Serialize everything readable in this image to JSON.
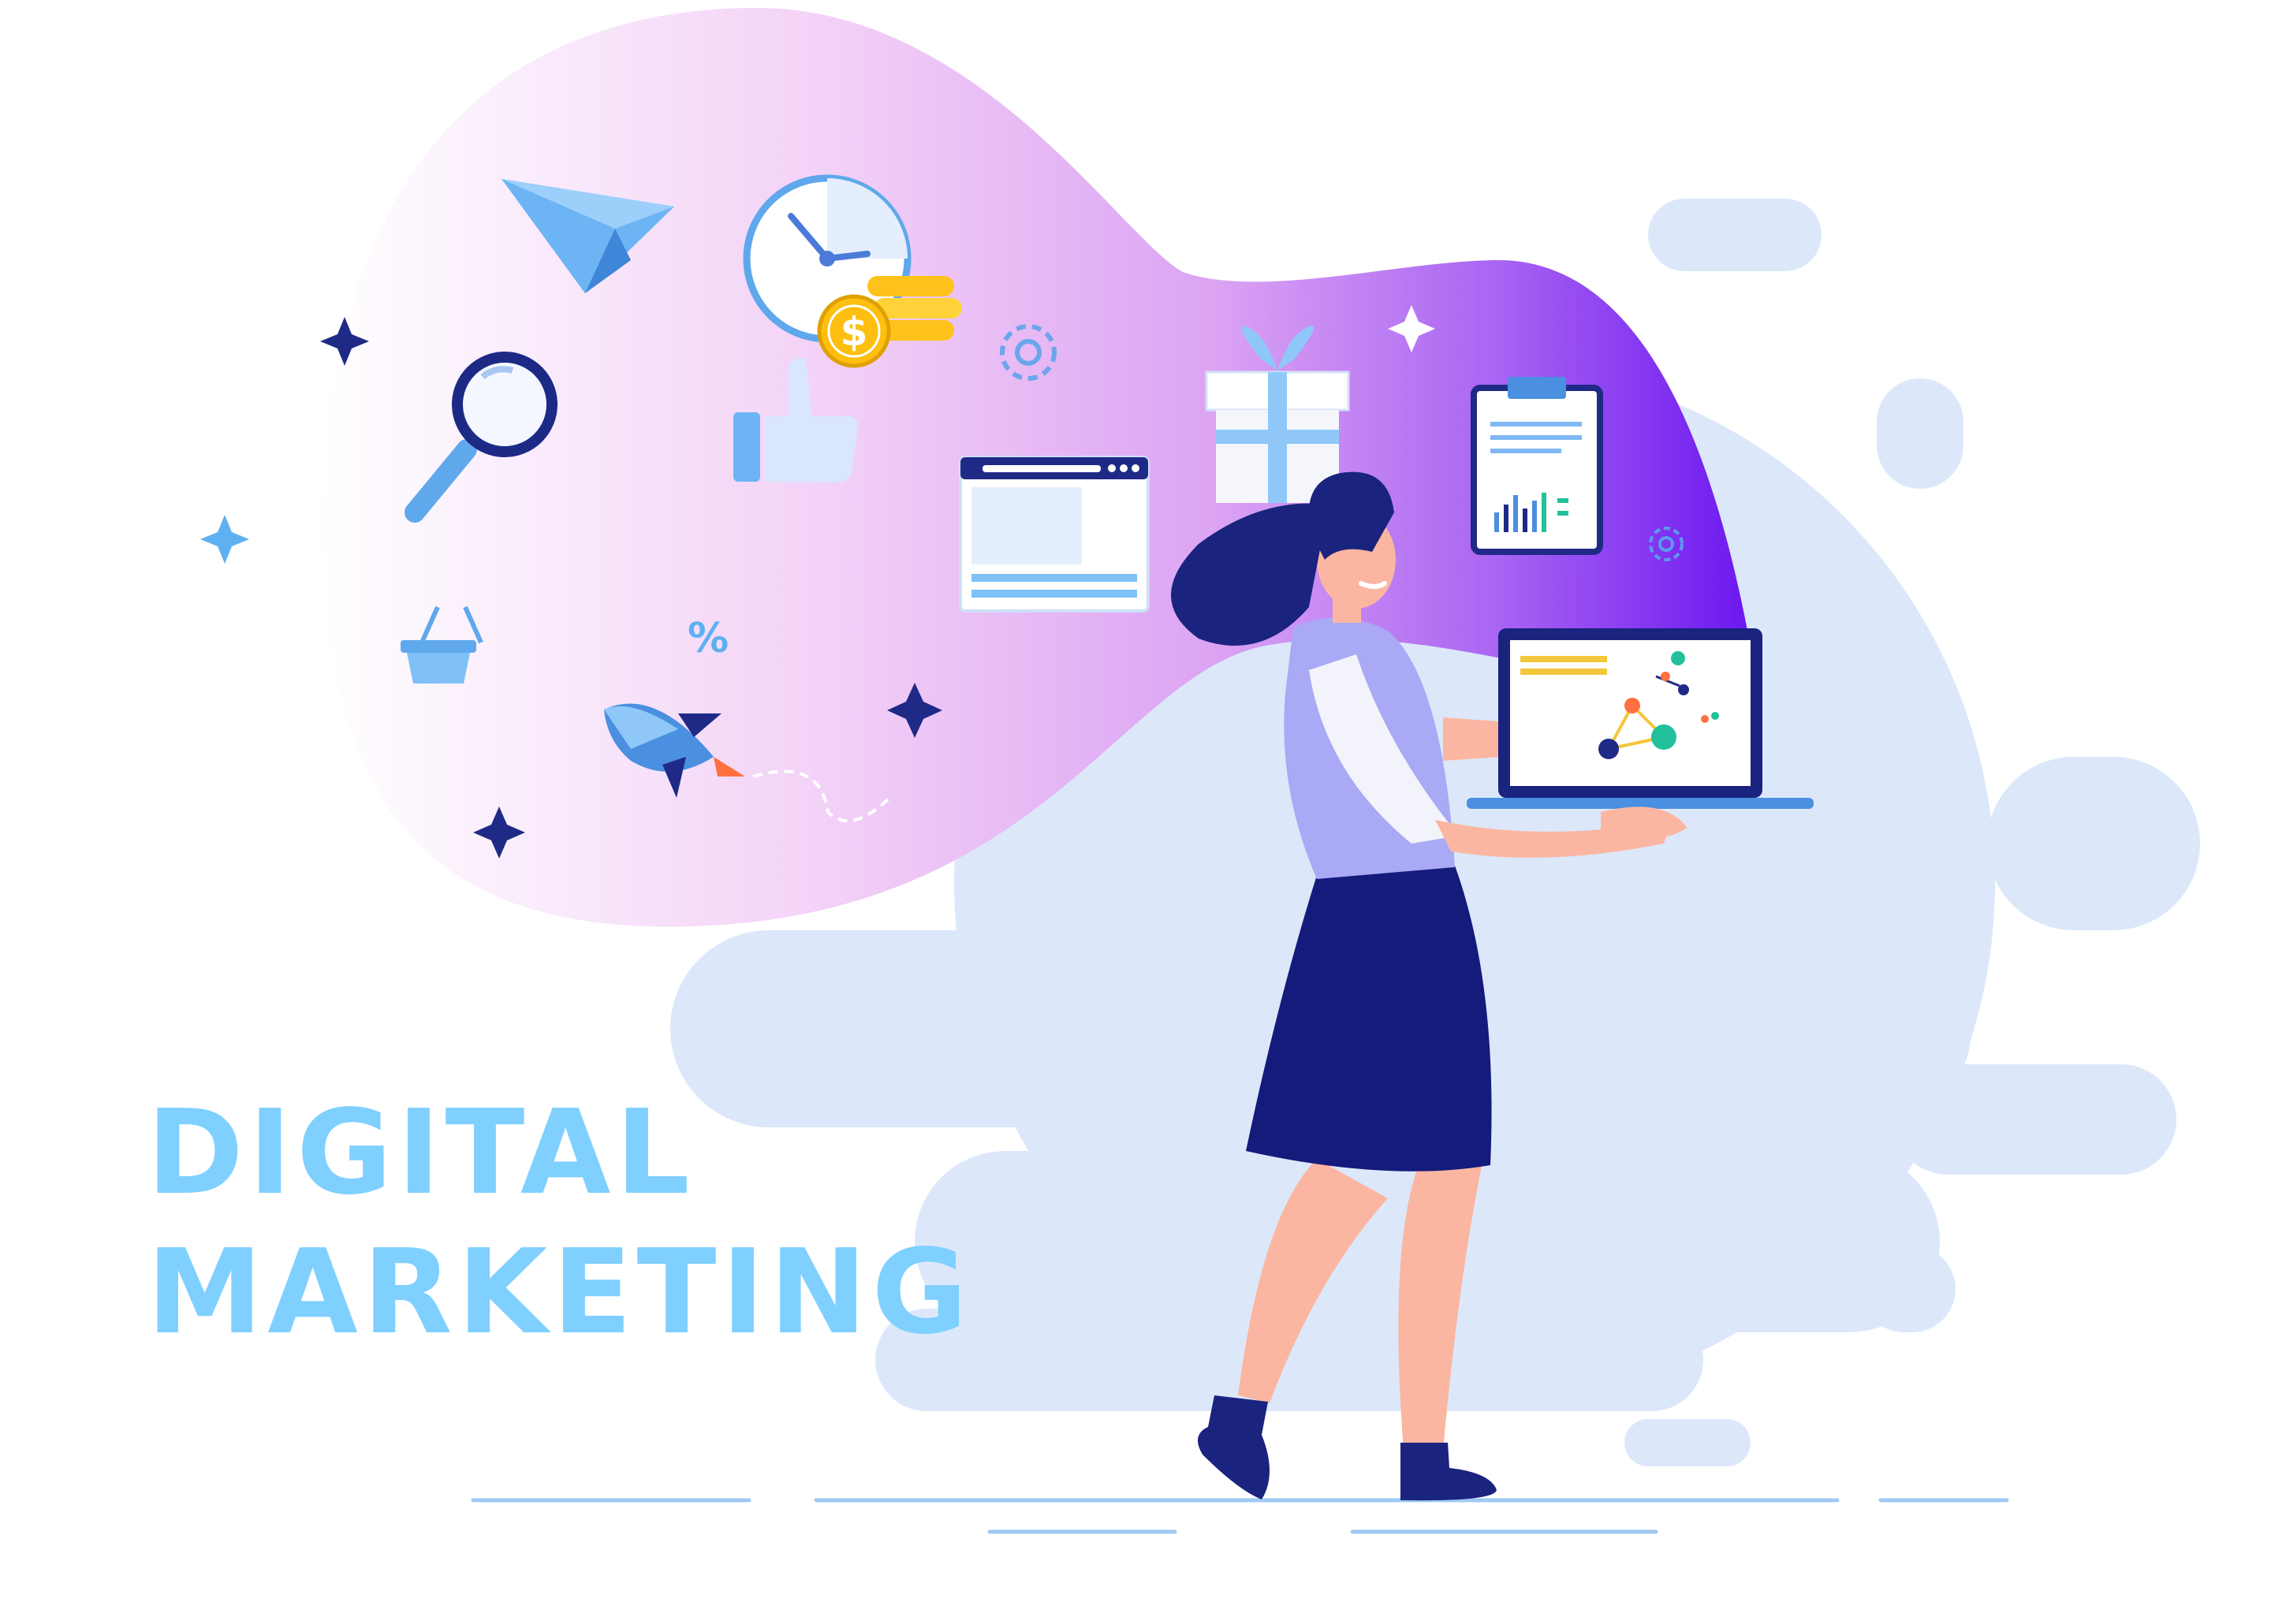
{
  "illustration": {
    "title_line_1": "DIGITAL",
    "title_line_2": "MARKETING",
    "percent_symbol": "%",
    "coin_symbol": "$"
  },
  "colors": {
    "title": "#7fd0ff",
    "cloud": "#dce8fa",
    "navy": "#151b7b",
    "accent_blue": "#5fb0f0",
    "gradient_start": "#ffffff",
    "gradient_mid": "#e9a8f6",
    "gradient_end": "#6a15f0",
    "skin": "#fbb6a2",
    "top": "#a9a9f5",
    "coin": "#ffcc22"
  },
  "icons": [
    "paper-plane-icon",
    "clock-icon",
    "coin-stack-icon",
    "gear-icon",
    "magnifier-icon",
    "thumbs-up-icon",
    "browser-window-icon",
    "gift-box-icon",
    "clipboard-chart-icon",
    "shopping-basket-icon",
    "percent-icon",
    "rocket-icon",
    "sparkle-icon",
    "laptop-icon"
  ]
}
